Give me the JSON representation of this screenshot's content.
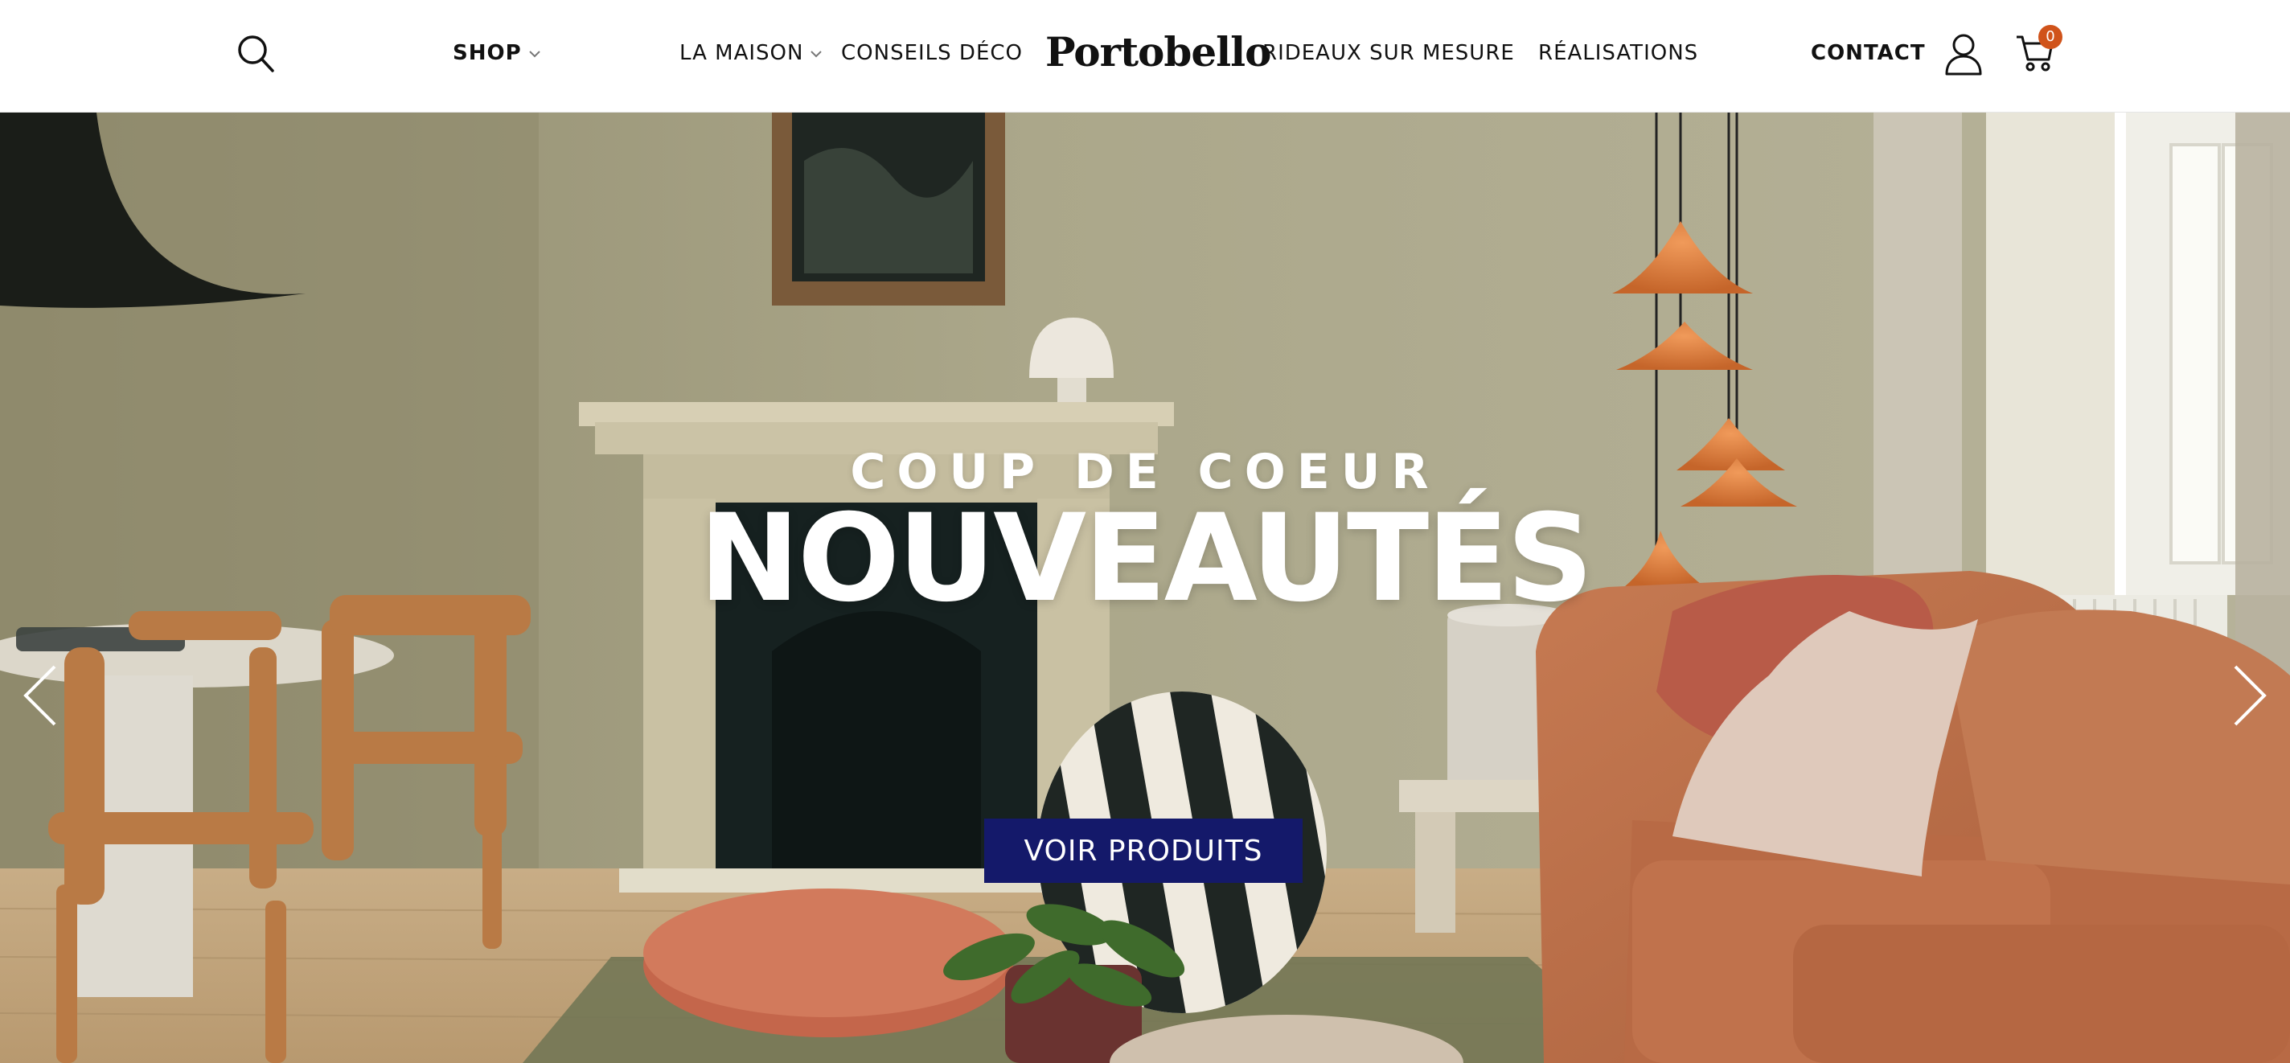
{
  "header": {
    "logo": "Portobello",
    "nav": {
      "shop": "SHOP",
      "la_maison": "LA MAISON",
      "conseils_deco": "CONSEILS DÉCO",
      "rideaux": "RIDEAUX SUR MESURE",
      "realisations": "RÉALISATIONS",
      "contact": "CONTACT"
    },
    "cart_count": "0",
    "icons": [
      "search-icon",
      "chevron-down-icon",
      "user-icon",
      "cart-icon"
    ]
  },
  "hero": {
    "kicker": "COUP DE COEUR",
    "title": "NOUVEAUTÉS",
    "cta_label": "VOIR PRODUITS",
    "icons": [
      "chevron-left-icon",
      "chevron-right-icon"
    ]
  },
  "colors": {
    "accent_badge": "#d0531a",
    "cta_background": "#14196a",
    "wall": "#a7a385",
    "sofa": "#c2754f"
  }
}
